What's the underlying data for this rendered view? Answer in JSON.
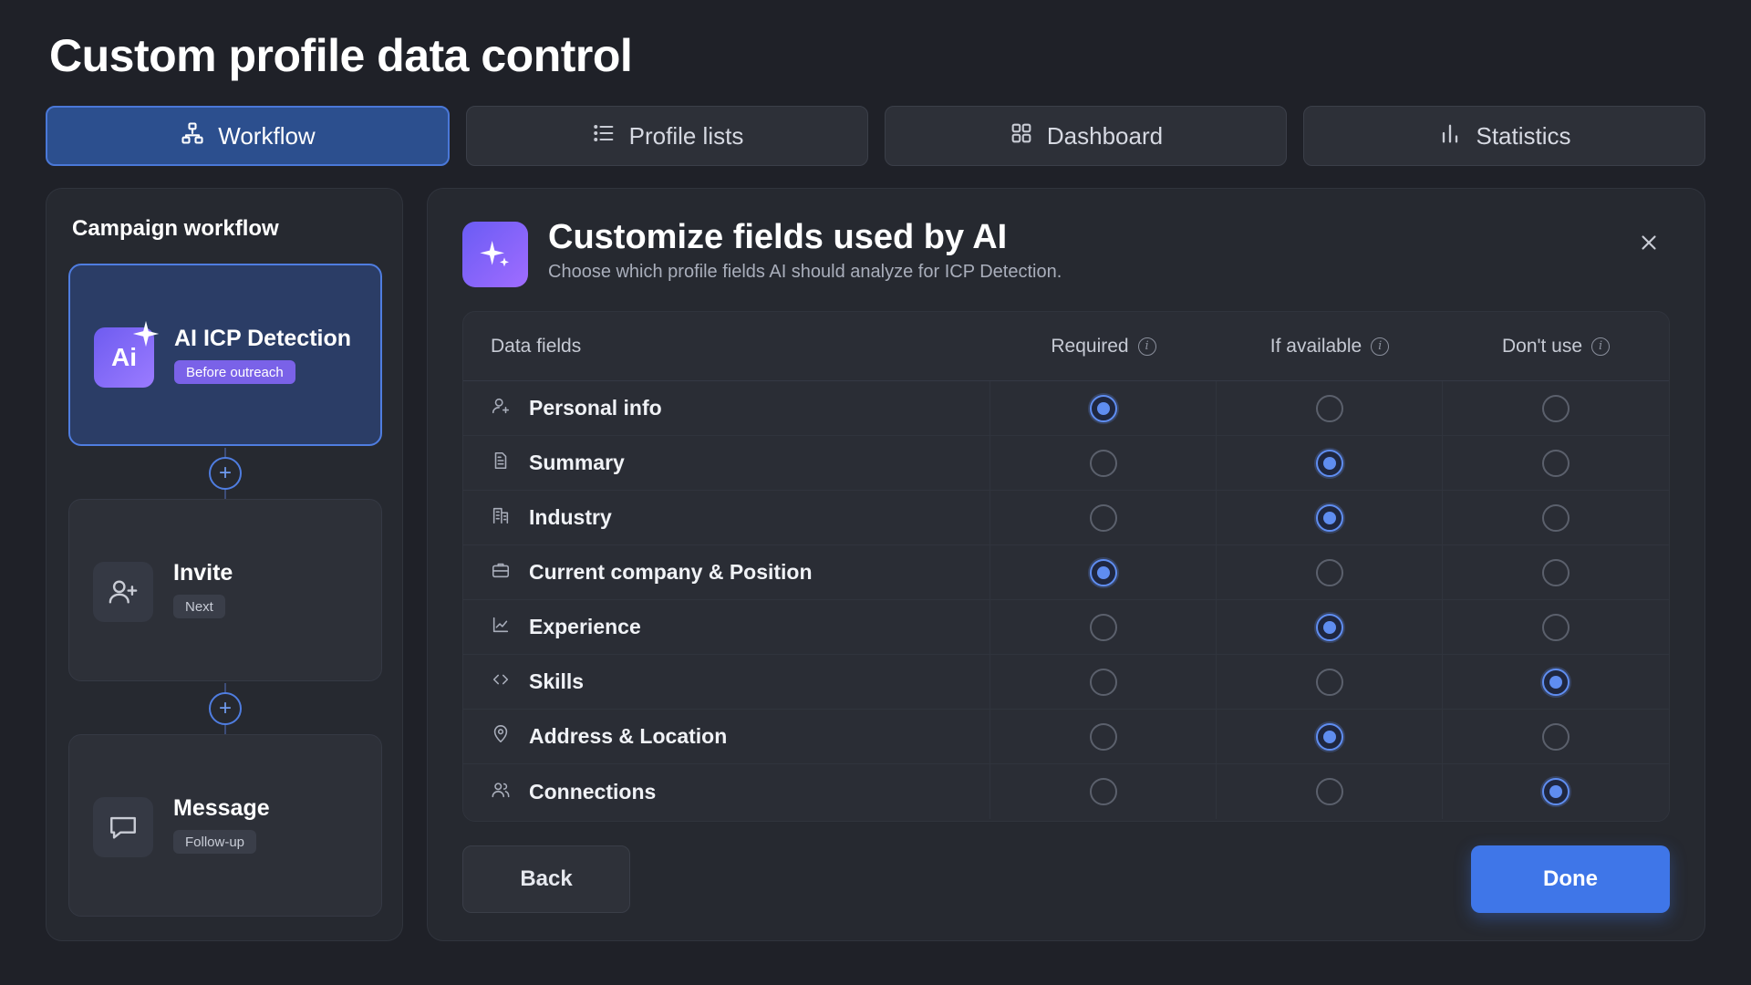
{
  "page": {
    "title": "Custom profile data control"
  },
  "tabs": [
    {
      "label": "Workflow",
      "icon": "workflow-icon",
      "active": true
    },
    {
      "label": "Profile lists",
      "icon": "list-icon",
      "active": false
    },
    {
      "label": "Dashboard",
      "icon": "grid-icon",
      "active": false
    },
    {
      "label": "Statistics",
      "icon": "bar-chart-icon",
      "active": false
    }
  ],
  "sidebar": {
    "title": "Campaign workflow",
    "steps": [
      {
        "icon_text": "Ai",
        "name": "AI ICP Detection",
        "badge": "Before outreach",
        "active": true
      },
      {
        "name": "Invite",
        "badge": "Next",
        "icon": "user-plus-icon",
        "active": false
      },
      {
        "name": "Message",
        "badge": "Follow-up",
        "icon": "chat-icon",
        "active": false
      }
    ]
  },
  "panel": {
    "title": "Customize fields used by AI",
    "subtitle": "Choose which profile fields AI should analyze for ICP Detection.",
    "table": {
      "headers": {
        "fields": "Data fields",
        "required": "Required",
        "if_available": "If available",
        "dont_use": "Don't use"
      },
      "info_glyph": "i",
      "rows": [
        {
          "label": "Personal info",
          "icon": "user-icon",
          "selected": "required"
        },
        {
          "label": "Summary",
          "icon": "document-icon",
          "selected": "if_available"
        },
        {
          "label": "Industry",
          "icon": "building-icon",
          "selected": "if_available"
        },
        {
          "label": "Current company & Position",
          "icon": "briefcase-icon",
          "selected": "required"
        },
        {
          "label": "Experience",
          "icon": "trend-icon",
          "selected": "if_available"
        },
        {
          "label": "Skills",
          "icon": "code-icon",
          "selected": "dont_use"
        },
        {
          "label": "Address & Location",
          "icon": "location-pin-icon",
          "selected": "if_available"
        },
        {
          "label": "Connections",
          "icon": "users-icon",
          "selected": "dont_use"
        }
      ]
    },
    "back_label": "Back",
    "done_label": "Done"
  },
  "colors": {
    "accent": "#3f76e8",
    "background": "#1f2128",
    "ai_gradient_start": "#6a5cf4",
    "ai_gradient_end": "#a06cff"
  }
}
